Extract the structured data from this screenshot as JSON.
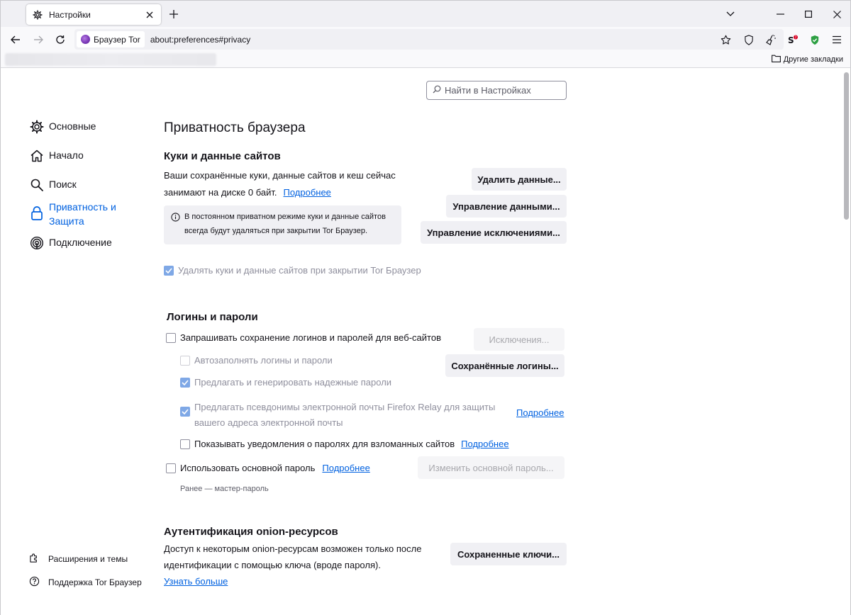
{
  "tab": {
    "title": "Настройки",
    "icon": "gear-icon"
  },
  "nav": {
    "identity_label": "Браузер Tor",
    "url": "about:preferences#privacy"
  },
  "bookmarks": {
    "other_label": "Другие закладки"
  },
  "search": {
    "placeholder": "Найти в Настройках"
  },
  "sidebar": {
    "items": [
      {
        "label": "Основные",
        "icon": "gear-icon"
      },
      {
        "label": "Начало",
        "icon": "home-icon"
      },
      {
        "label": "Поиск",
        "icon": "search-icon"
      },
      {
        "label": "Приватность и",
        "label2": "Защита",
        "icon": "lock-icon"
      },
      {
        "label": "Подключение",
        "icon": "connection-icon"
      }
    ],
    "footer": [
      {
        "label": "Расширения и темы",
        "icon": "puzzle-icon"
      },
      {
        "label": "Поддержка Tor Браузер",
        "icon": "help-icon"
      }
    ]
  },
  "page": {
    "title": "Приватность браузера"
  },
  "cookies": {
    "heading": "Куки и данные сайтов",
    "desc1": "Ваши сохранённые куки, данные сайтов и кеш сейчас",
    "desc2": "занимают на диске 0 байт.",
    "learn_more": "Подробнее",
    "info_line1": "В постоянном приватном режиме куки и данные сайтов",
    "info_line2": "всегда будут удаляться при закрытии Tor Браузер.",
    "btn_clear": "Удалить данные...",
    "btn_manage": "Управление данными...",
    "btn_exceptions": "Управление исключениями...",
    "delete_on_close": "Удалять куки и данные сайтов при закрытии Tor Браузер"
  },
  "logins": {
    "heading": "Логины и пароли",
    "ask_save": "Запрашивать сохранение логинов и паролей для веб-сайтов",
    "autofill": "Автозаполнять логины и пароли",
    "suggest": "Предлагать и генерировать надежные пароли",
    "relay_line1": "Предлагать псевдонимы электронной почты Firefox Relay для защиты",
    "relay_line2": "вашего адреса электронной почты",
    "relay_learn": "Подробнее",
    "breach": "Показывать уведомления о паролях для взломанных сайтов",
    "breach_learn": "Подробнее",
    "primary": "Использовать основной пароль",
    "primary_learn": "Подробнее",
    "primary_note": "Ранее — мастер-пароль",
    "btn_exceptions": "Исключения...",
    "btn_saved": "Сохранённые логины...",
    "btn_change_primary": "Изменить основной пароль..."
  },
  "onion": {
    "heading": "Аутентификация onion-ресурсов",
    "desc1": "Доступ к некоторым onion-ресурсам возможен только после",
    "desc2": "идентификации с помощью ключа (вроде пароля).",
    "learn_more": "Узнать больше",
    "btn_keys": "Сохраненные ключи..."
  },
  "colors": {
    "accent": "#0061e0",
    "tor_purple": "#7c3ab8",
    "shield_green": "#2ea043"
  }
}
